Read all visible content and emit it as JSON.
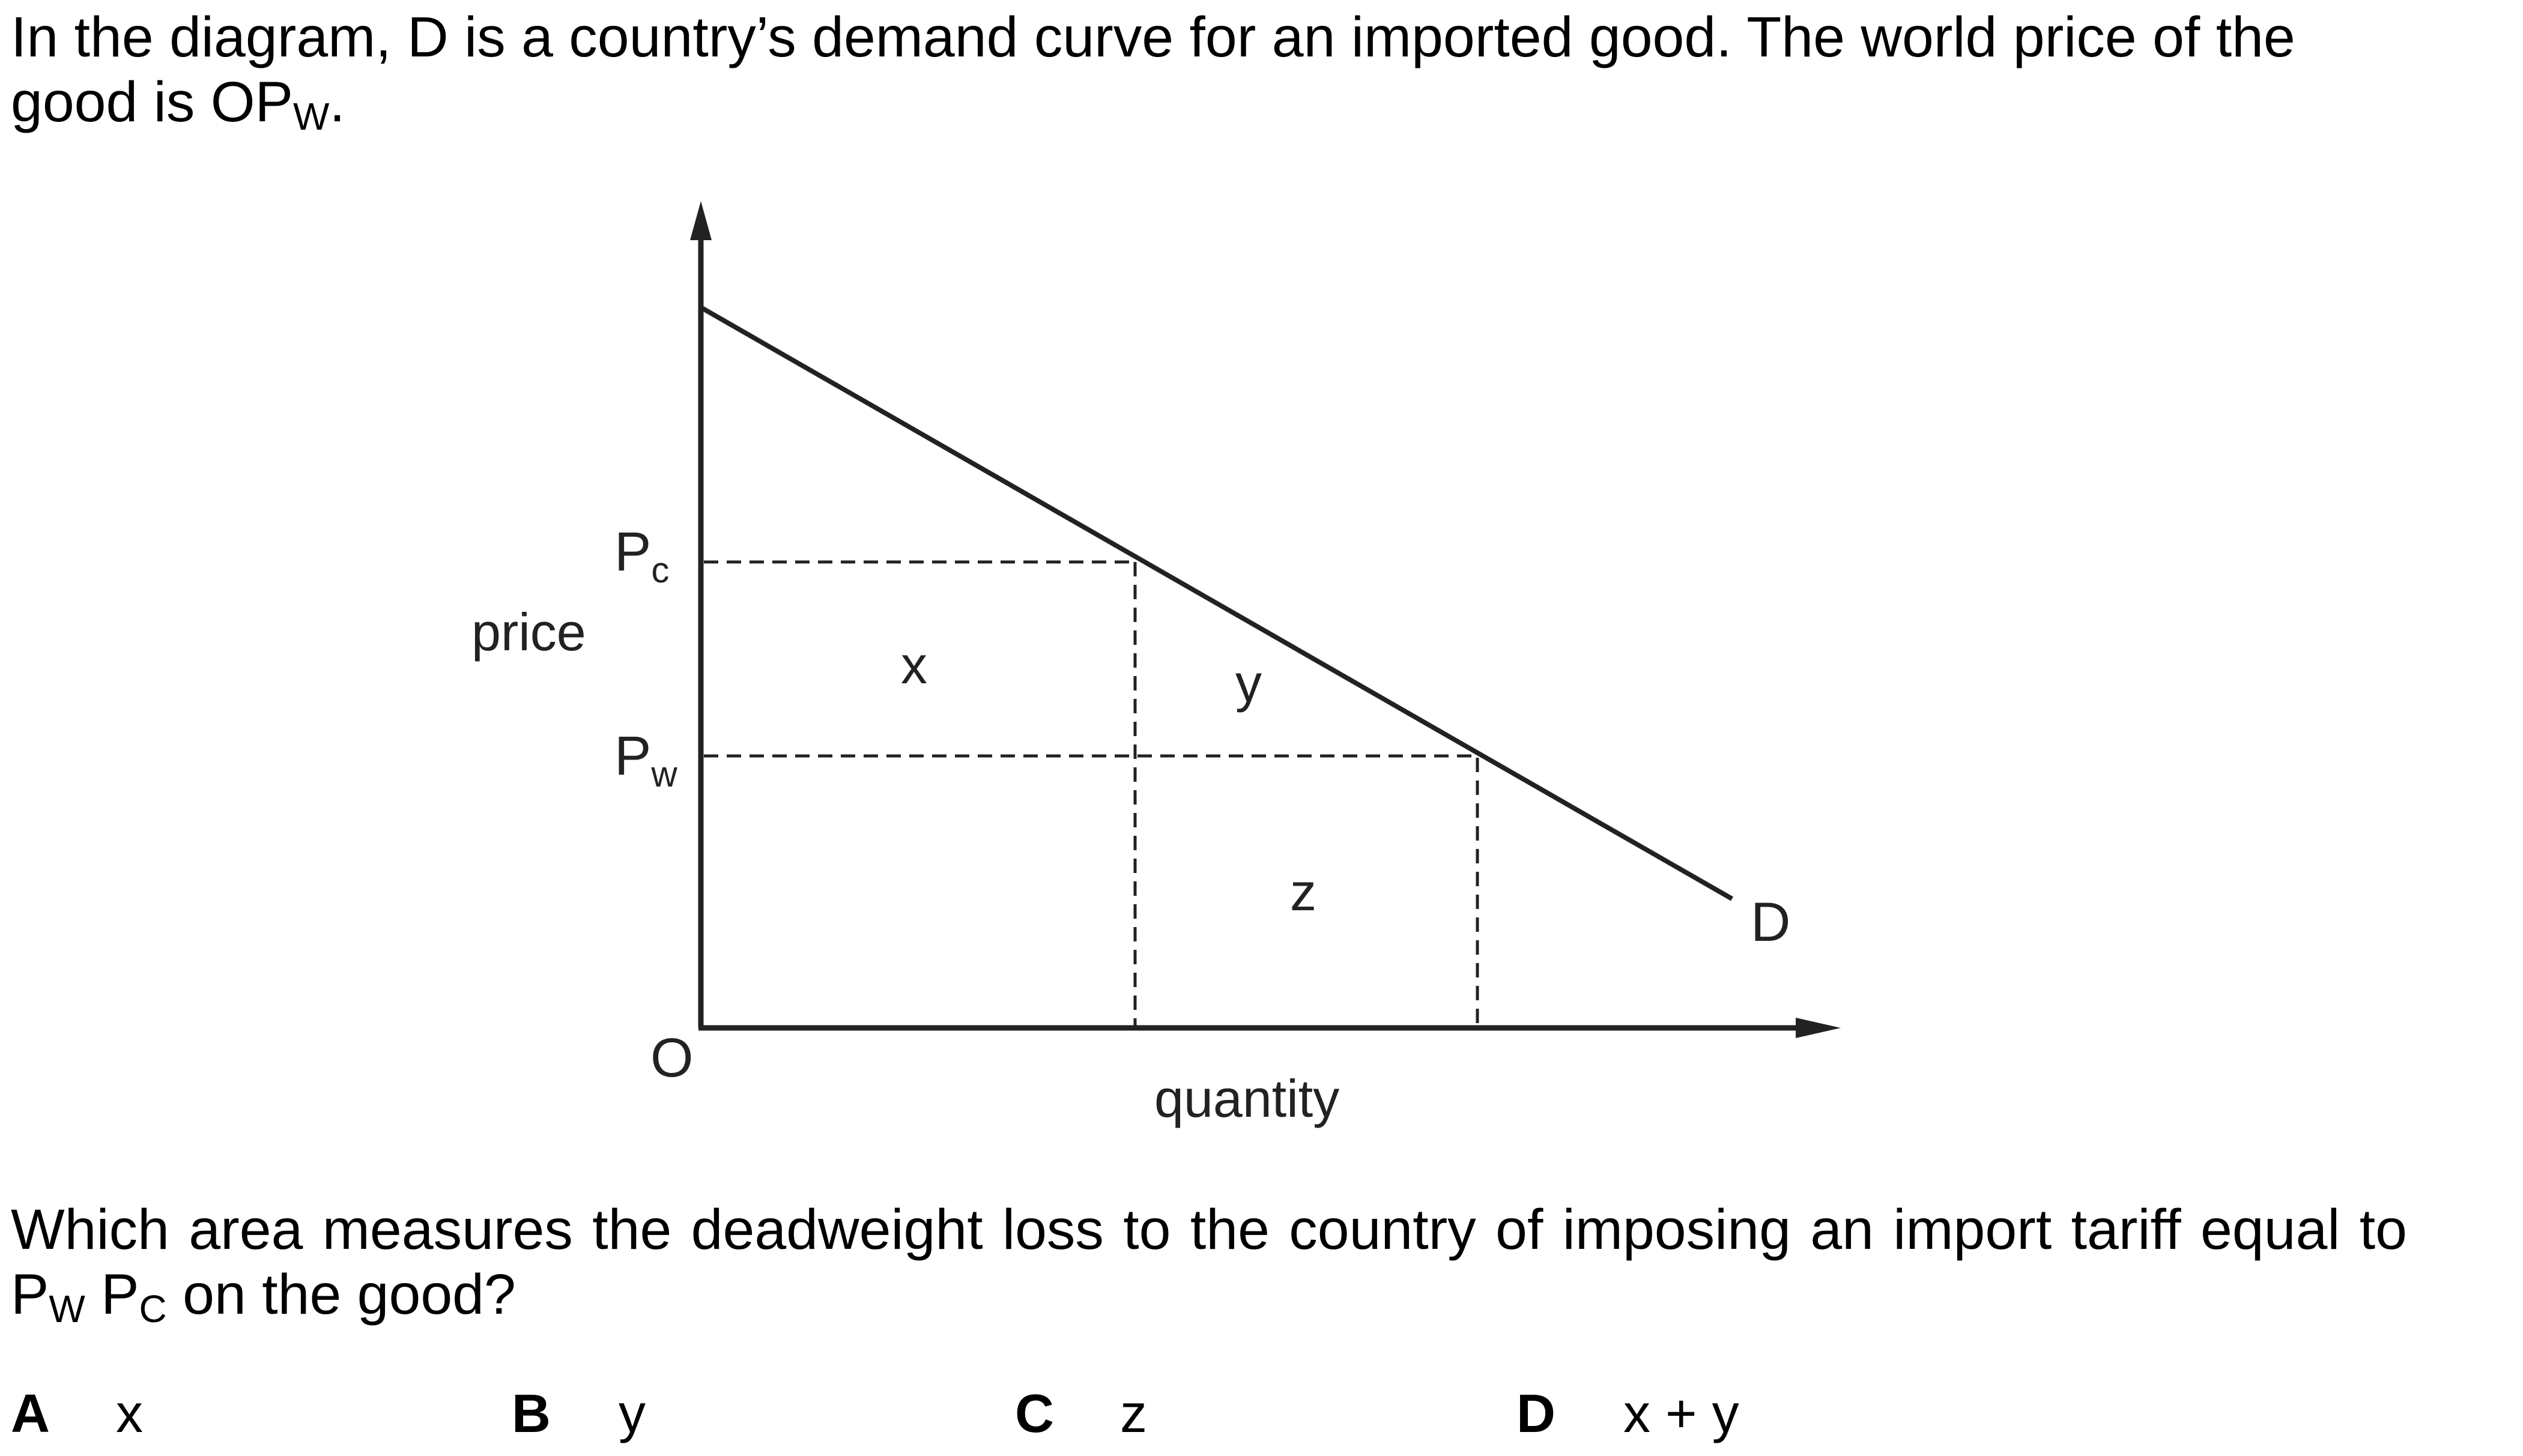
{
  "question": {
    "intro_part1": "In the diagram, D is a country’s demand curve for an imported good. The world price of the good is OP",
    "intro_sub": "W",
    "intro_part2": ".",
    "stem_part1": "Which area measures the deadweight loss to the country of imposing an import tariff equal to P",
    "stem_sub1": "W",
    "stem_part2": " P",
    "stem_sub2": "C",
    "stem_part3": " on the good?"
  },
  "diagram": {
    "y_axis_label": "price",
    "x_axis_label": "quantity",
    "origin_label": "O",
    "price_levels": [
      {
        "main": "P",
        "sub": "c"
      },
      {
        "main": "P",
        "sub": "w"
      }
    ],
    "area_labels": [
      "x",
      "y",
      "z"
    ],
    "curve_label": "D"
  },
  "options": [
    {
      "letter": "A",
      "answer": "x"
    },
    {
      "letter": "B",
      "answer": "y"
    },
    {
      "letter": "C",
      "answer": "z"
    },
    {
      "letter": "D",
      "answer": "x + y"
    }
  ]
}
